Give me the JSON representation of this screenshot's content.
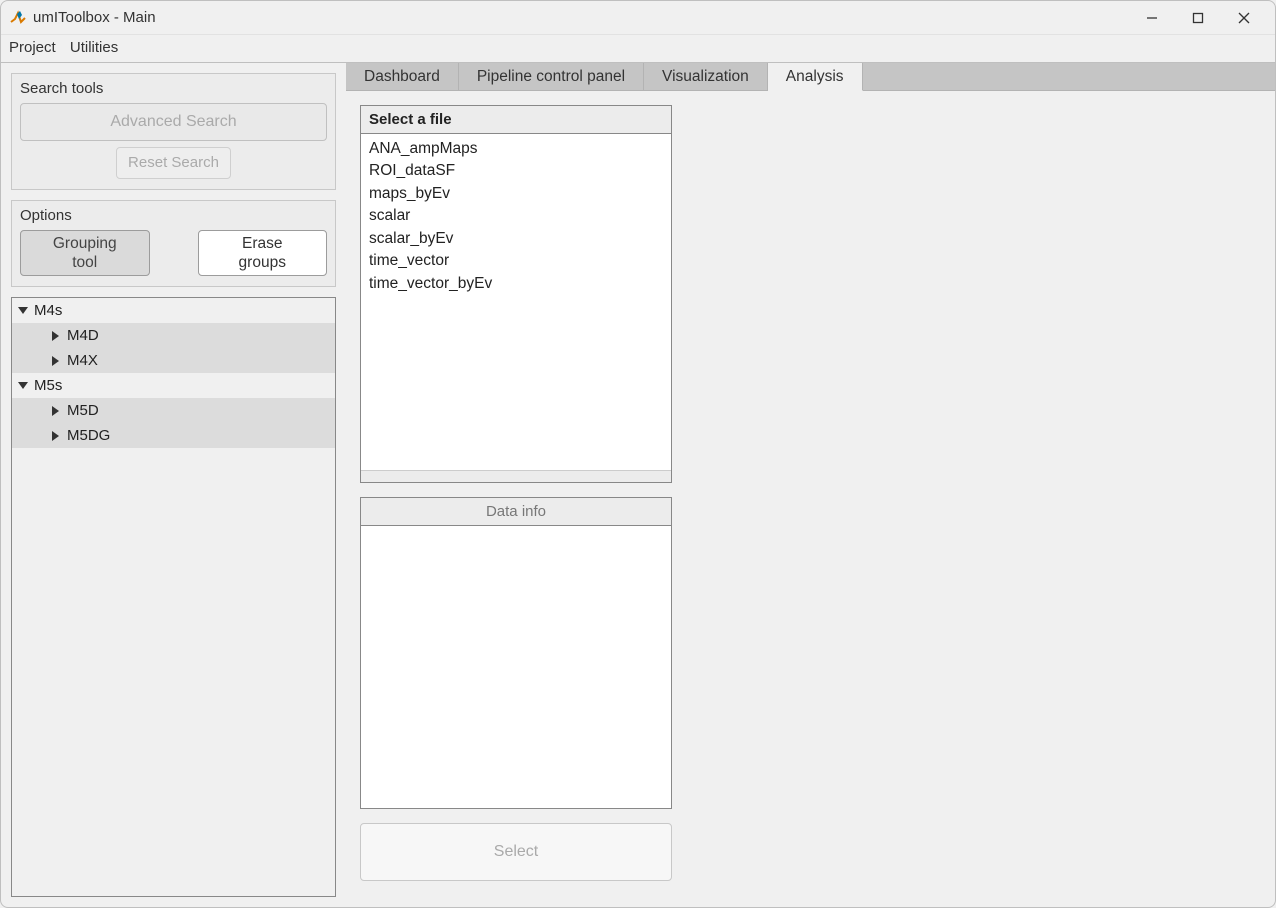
{
  "window": {
    "title": "umIToolbox - Main"
  },
  "menubar": {
    "project": "Project",
    "utilities": "Utilities"
  },
  "search": {
    "title": "Search tools",
    "advanced": "Advanced Search",
    "reset": "Reset Search"
  },
  "options": {
    "title": "Options",
    "grouping_l1": "Grouping",
    "grouping_l2": "tool",
    "erase_l1": "Erase",
    "erase_l2": "groups"
  },
  "tree": [
    {
      "label": "M4s",
      "children": [
        "M4D",
        "M4X"
      ]
    },
    {
      "label": "M5s",
      "children": [
        "M5D",
        "M5DG"
      ]
    }
  ],
  "tabs": {
    "dashboard": "Dashboard",
    "pipeline": "Pipeline control panel",
    "visualization": "Visualization",
    "analysis": "Analysis"
  },
  "analysis": {
    "select_file_header": "Select a file",
    "files": [
      "ANA_ampMaps",
      "ROI_dataSF",
      "maps_byEv",
      "scalar",
      "scalar_byEv",
      "time_vector",
      "time_vector_byEv"
    ],
    "data_info_header": "Data info",
    "select_button": "Select"
  }
}
